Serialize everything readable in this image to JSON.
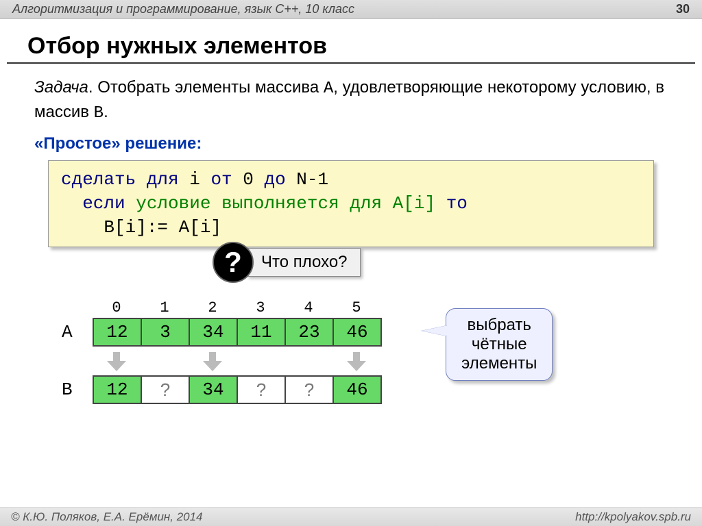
{
  "header": {
    "subject": "Алгоритмизация и программирование, язык C++, 10 класс",
    "page": "30"
  },
  "title": "Отбор нужных элементов",
  "task": {
    "label": "Задача",
    "text_before": ". Отобрать элементы массива ",
    "arr_a": "A",
    "text_mid": ", удовлетворяющие некоторому условию, в массив ",
    "arr_b": "B",
    "text_end": "."
  },
  "solution_heading": "«Простое» решение:",
  "code": {
    "l1_a": "сделать для",
    "l1_b": " i ",
    "l1_c": "от",
    "l1_d": " 0 ",
    "l1_e": "до",
    "l1_f": " N-1",
    "l2_a": "  если ",
    "l2_b": "условие выполняется для A[i]",
    "l2_c": " то",
    "l3": "    B[i]:= A[i]"
  },
  "question": {
    "mark": "?",
    "text": "Что плохо?"
  },
  "arrays": {
    "indices": [
      "0",
      "1",
      "2",
      "3",
      "4",
      "5"
    ],
    "A_label": "A",
    "A": [
      "12",
      "3",
      "34",
      "11",
      "23",
      "46"
    ],
    "B_label": "B",
    "B": [
      "12",
      "?",
      "34",
      "?",
      "?",
      "46"
    ],
    "B_green": [
      true,
      false,
      true,
      false,
      false,
      true
    ],
    "arrow_on": [
      true,
      false,
      true,
      false,
      false,
      true
    ]
  },
  "callout": {
    "line1": "выбрать",
    "line2": "чётные",
    "line3": "элементы"
  },
  "footer": {
    "left": "© К.Ю. Поляков, Е.А. Ерёмин, 2014",
    "right": "http://kpolyakov.spb.ru"
  }
}
